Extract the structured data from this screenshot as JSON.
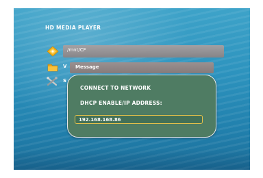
{
  "app": {
    "title": "HD MEDIA PLAYER"
  },
  "browser": {
    "current_path": "/mnt/CF",
    "rows": [
      {
        "icon": "compact-flash-icon",
        "label_visible": "/mnt/CF"
      },
      {
        "icon": "folder-icon",
        "label_visible": "V"
      },
      {
        "icon": "tools-icon",
        "label_visible": "S"
      }
    ]
  },
  "dialog": {
    "title": "Message",
    "line1": "CONNECT TO NETWORK",
    "line2": "DHCP ENABLE/IP ADDRESS:",
    "ip_value": "192.168.168.86"
  },
  "colors": {
    "dialog_bg": "#4f7c63",
    "field_border": "#e6c24a",
    "header_bg": "#8f8686",
    "water": "#2d93be"
  }
}
